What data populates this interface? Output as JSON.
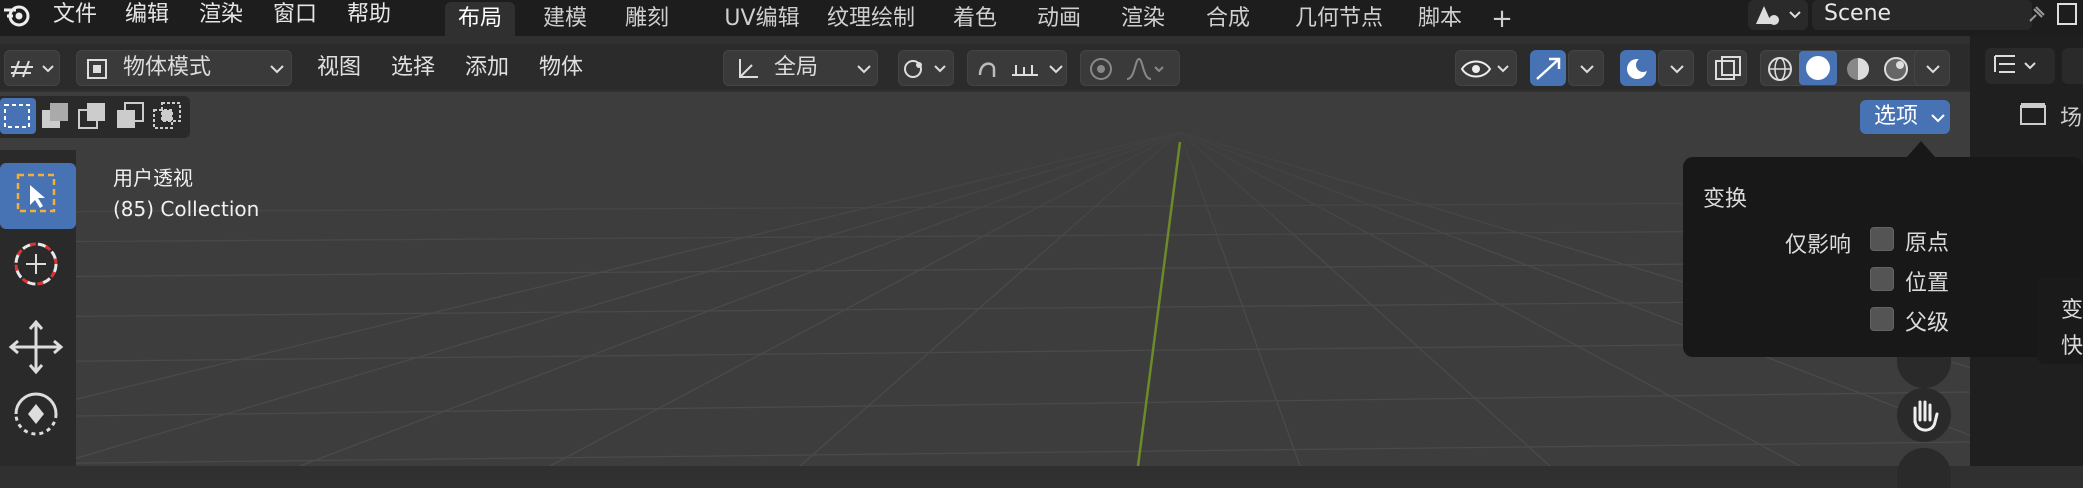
{
  "menu": {
    "file": "文件",
    "edit": "编辑",
    "render": "渲染",
    "window": "窗口",
    "help": "帮助"
  },
  "workspaces": {
    "tabs": [
      "布局",
      "建模",
      "雕刻",
      "UV编辑",
      "纹理绘制",
      "着色",
      "动画",
      "渲染",
      "合成",
      "几何节点",
      "脚本"
    ],
    "active_index": 0,
    "add_symbol": "+"
  },
  "scene": {
    "name": "Scene"
  },
  "header": {
    "mode_label": "物体模式",
    "view": "视图",
    "select": "选择",
    "add": "添加",
    "object": "物体",
    "orientation": "全局",
    "options_label": "选项"
  },
  "viewport": {
    "view_name": "用户透视",
    "collection": "(85) Collection"
  },
  "options_popover": {
    "section_title": "变换",
    "affect_only_label": "仅影响",
    "options": [
      {
        "label": "原点",
        "checked": false
      },
      {
        "label": "位置",
        "checked": false
      },
      {
        "label": "父级",
        "checked": false
      }
    ]
  },
  "right_partial": {
    "label1": "场",
    "side1": "变",
    "side2": "快"
  },
  "colors": {
    "accent": "#4772b3",
    "background": "#3d3d3d",
    "topbar": "#1d1d1d"
  }
}
